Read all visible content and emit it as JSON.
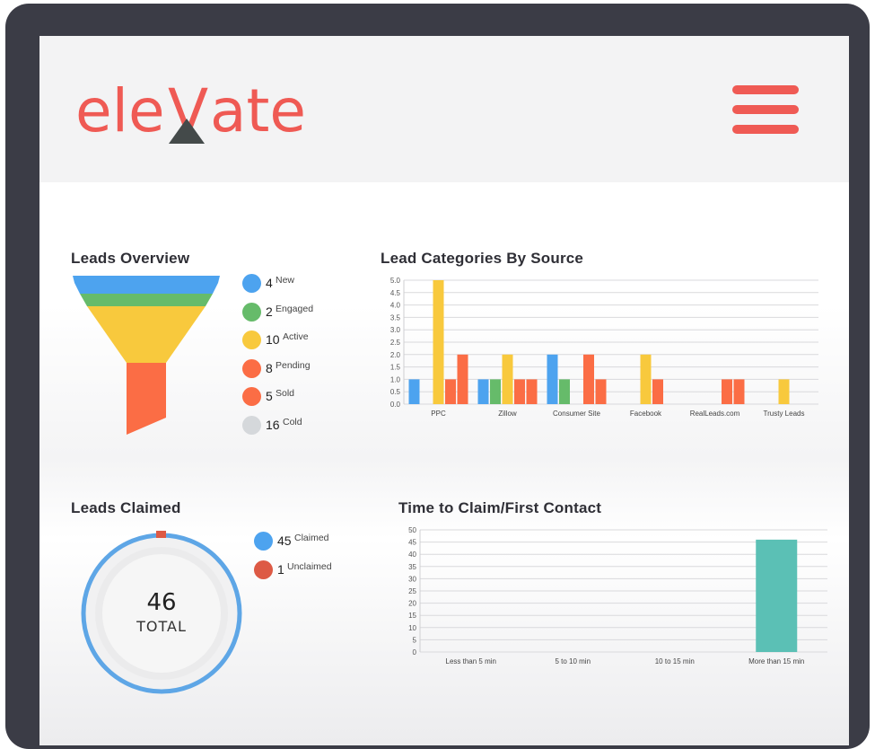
{
  "app": {
    "logo_text": "ele ate",
    "logo_letter_v": "V",
    "colors": {
      "brand": "#ef5a54",
      "frame": "#3b3c46",
      "logo_triangle": "#444a4a"
    }
  },
  "header": {
    "menu_icon": "hamburger-menu-icon"
  },
  "leads_overview": {
    "title": "Leads Overview",
    "items": [
      {
        "count": "4",
        "label": "New",
        "color": "#4da3ef"
      },
      {
        "count": "2",
        "label": "Engaged",
        "color": "#66bb6a"
      },
      {
        "count": "10",
        "label": "Active",
        "color": "#f8c93d"
      },
      {
        "count": "8",
        "label": "Pending",
        "color": "#fb6d45"
      },
      {
        "count": "5",
        "label": "Sold",
        "color": "#fb6d45"
      },
      {
        "count": "16",
        "label": "Cold",
        "color": "#d5d8db"
      }
    ]
  },
  "leads_claimed": {
    "title": "Leads Claimed",
    "total": "46",
    "total_label": "TOTAL",
    "items": [
      {
        "count": "45",
        "label": "Claimed",
        "color": "#4da3ef"
      },
      {
        "count": "1",
        "label": "Unclaimed",
        "color": "#dd5a45"
      }
    ]
  },
  "chart_data": [
    {
      "type": "bar",
      "title": "Lead Categories By Source",
      "categories": [
        "PPC",
        "Zillow",
        "Consumer Site",
        "Facebook",
        "RealLeads.com",
        "Trusty Leads"
      ],
      "ylim": [
        0,
        5
      ],
      "yticks": [
        "0.0",
        "0.5",
        "1.0",
        "1.5",
        "2.0",
        "2.5",
        "3.0",
        "3.5",
        "4.0",
        "4.5",
        "5.0"
      ],
      "series": [
        {
          "color": "#4da3ef",
          "values": [
            1,
            1,
            2,
            0,
            0,
            0
          ]
        },
        {
          "color": "#66bb6a",
          "values": [
            0,
            1,
            1,
            0,
            0,
            0
          ]
        },
        {
          "color": "#f8c93d",
          "values": [
            5,
            2,
            0,
            2,
            0,
            1
          ]
        },
        {
          "color": "#fb6d45",
          "values": [
            1,
            1,
            2,
            1,
            1,
            0
          ]
        },
        {
          "color": "#fb6d45",
          "values": [
            2,
            1,
            1,
            0,
            1,
            0
          ]
        }
      ],
      "grid": true
    },
    {
      "type": "bar",
      "title": "Time to Claim/First Contact",
      "categories": [
        "Less than 5 min",
        "5 to 10 min",
        "10 to 15 min",
        "More than 15 min"
      ],
      "ylim": [
        0,
        50
      ],
      "yticks": [
        "0",
        "5",
        "10",
        "15",
        "20",
        "25",
        "30",
        "35",
        "40",
        "45",
        "50"
      ],
      "series": [
        {
          "color": "#5bc0b5",
          "values": [
            0,
            0,
            0,
            46
          ]
        }
      ],
      "grid": true
    }
  ]
}
